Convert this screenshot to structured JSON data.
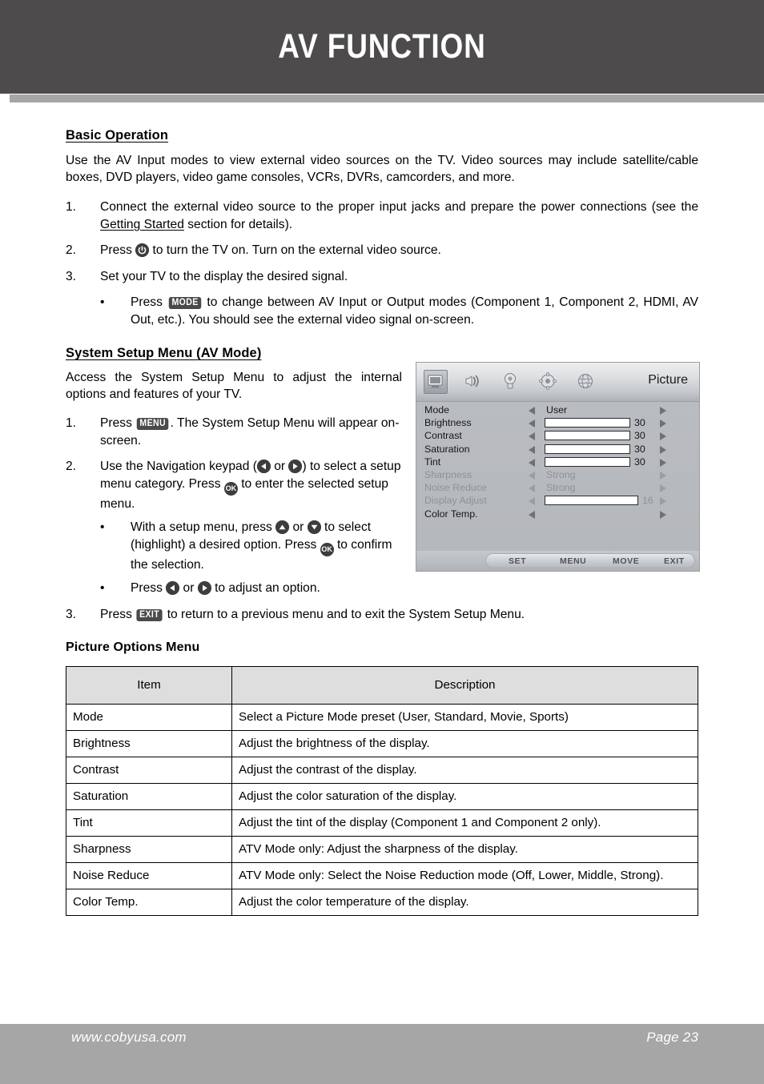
{
  "header": {
    "title": "AV FUNCTION"
  },
  "basic": {
    "heading": "Basic Operation",
    "intro": "Use the AV Input modes to view external video sources on the TV. Video sources may include satellite/cable boxes, DVD players, video game consoles, VCRs, DVRs, camcorders, and more.",
    "steps": [
      {
        "num": "1.",
        "pre": "Connect the external video source to the proper input jacks and prepare the power connections (see the ",
        "link": "Getting Started",
        "post": " section for details)."
      },
      {
        "num": "2.",
        "pre": "Press ",
        "key": "power-icon",
        "post": " to turn the TV on. Turn on the external video source."
      },
      {
        "num": "3.",
        "pre": "Set your TV to the display the desired signal.",
        "key": "",
        "post": ""
      }
    ],
    "bullet": {
      "marker": "•",
      "pre": "Press ",
      "key": "MODE",
      "post": " to change between AV Input or Output modes (Component 1, Component 2, HDMI, AV Out, etc.). You should see the external video signal on-screen."
    }
  },
  "setup": {
    "heading": "System Setup Menu (AV Mode)",
    "intro": "Access the System Setup Menu to adjust the internal options and features of your TV.",
    "step1": {
      "num": "1.",
      "pre": "Press ",
      "key": "MENU",
      "post": ". The System Setup Menu will appear on-screen."
    },
    "step2": {
      "num": "2.",
      "a": "Use the Navigation keypad (",
      "b": " or ",
      "c": ") to select a setup menu category. Press ",
      "d": " to enter the selected setup menu."
    },
    "step2_bullet1": {
      "marker": "•",
      "a": "With a setup menu, press ",
      "b": " or ",
      "c": " to select (highlight) a desired option. Press ",
      "d": " to confirm the selection."
    },
    "step2_bullet2": {
      "marker": "•",
      "a": "Press ",
      "b": " or ",
      "c": " to adjust an option."
    },
    "step3": {
      "num": "3.",
      "pre": "Press ",
      "key": "EXIT",
      "post": " to return to a previous menu and to exit the System Setup Menu."
    }
  },
  "osd": {
    "title": "Picture",
    "icons": [
      "picture-icon",
      "sound-icon",
      "lock-icon",
      "setup-icon",
      "language-icon"
    ],
    "rows": [
      {
        "label": "Mode",
        "type": "option",
        "value": "User",
        "dim": false
      },
      {
        "label": "Brightness",
        "type": "slider",
        "value": "30",
        "fill": 50,
        "dim": false
      },
      {
        "label": "Contrast",
        "type": "slider",
        "value": "30",
        "fill": 50,
        "dim": false
      },
      {
        "label": "Saturation",
        "type": "slider",
        "value": "30",
        "fill": 50,
        "dim": false
      },
      {
        "label": "Tint",
        "type": "slider",
        "value": "30",
        "fill": 50,
        "dim": false
      },
      {
        "label": "Sharpness",
        "type": "option",
        "value": "Strong",
        "dim": true
      },
      {
        "label": "Noise Reduce",
        "type": "option",
        "value": "Strong",
        "dim": true
      },
      {
        "label": "Display Adjust",
        "type": "slider",
        "value": "16",
        "fill": 50,
        "dim": true,
        "wide": true
      },
      {
        "label": "Color Temp.",
        "type": "empty",
        "value": "",
        "dim": false
      }
    ],
    "footer_keys": [
      "SET",
      "MENU",
      "MOVE",
      "EXIT"
    ]
  },
  "table": {
    "heading": "Picture Options Menu",
    "columns": [
      "Item",
      "Description"
    ],
    "rows": [
      {
        "item": "Mode",
        "desc": "Select a Picture Mode preset (User, Standard, Movie, Sports)"
      },
      {
        "item": "Brightness",
        "desc": "Adjust the brightness of the display."
      },
      {
        "item": "Contrast",
        "desc": "Adjust the contrast of the display."
      },
      {
        "item": "Saturation",
        "desc": "Adjust the color saturation of the display."
      },
      {
        "item": "Tint",
        "desc": "Adjust the tint of the display (Component 1 and Component 2 only)."
      },
      {
        "item": "Sharpness",
        "desc": "ATV Mode only: Adjust the sharpness of the display."
      },
      {
        "item": "Noise Reduce",
        "desc": "ATV Mode only: Select the Noise Reduction mode (Off, Lower, Middle, Strong)."
      },
      {
        "item": "Color Temp.",
        "desc": "Adjust the color temperature of the display."
      }
    ]
  },
  "footer": {
    "url": "www.cobyusa.com",
    "page": "Page 23"
  },
  "colors": {
    "header_band": "#4d4b4c",
    "rule": "#a6a6a6",
    "footer_band": "#a6a6a6",
    "table_header": "#dedede",
    "key_badge": "#4a4a4a"
  }
}
